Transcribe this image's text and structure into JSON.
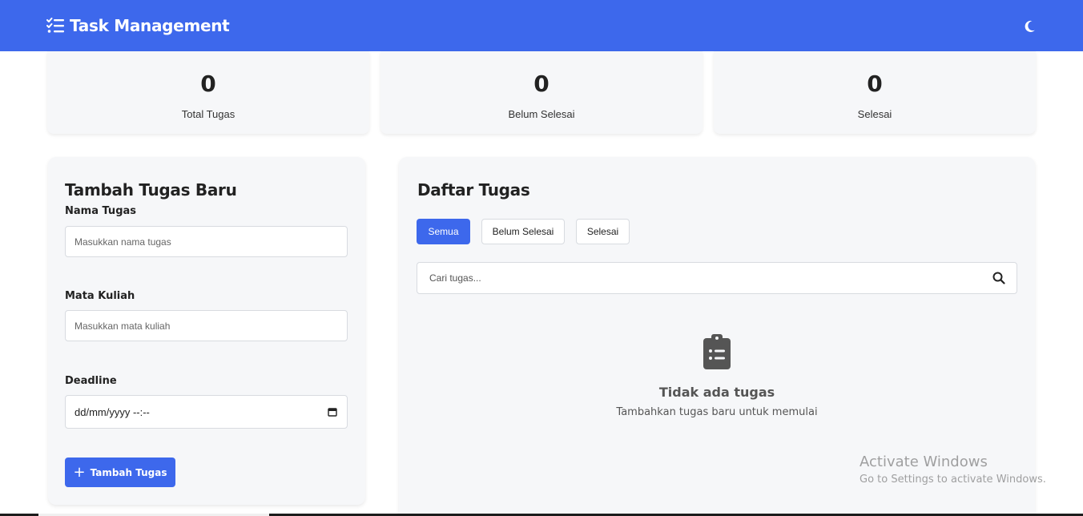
{
  "header": {
    "title": "Task Management",
    "accent": "#3d68ec",
    "theme_toggle_icon": "moon-icon"
  },
  "stats": [
    {
      "value": "0",
      "label": "Total Tugas"
    },
    {
      "value": "0",
      "label": "Belum Selesai"
    },
    {
      "value": "0",
      "label": "Selesai"
    }
  ],
  "form": {
    "title": "Tambah Tugas Baru",
    "name_label": "Nama Tugas",
    "name_placeholder": "Masukkan nama tugas",
    "course_label": "Mata Kuliah",
    "course_placeholder": "Masukkan mata kuliah",
    "deadline_label": "Deadline",
    "deadline_value": "dd/mm/yyyy --:--",
    "submit_label": "Tambah Tugas"
  },
  "list": {
    "title": "Daftar Tugas",
    "filters": [
      "Semua",
      "Belum Selesai",
      "Selesai"
    ],
    "active_filter": "Semua",
    "search_placeholder": "Cari tugas...",
    "empty_title": "Tidak ada tugas",
    "empty_subtitle": "Tambahkan tugas baru untuk memulai"
  },
  "watermark": {
    "title": "Activate Windows",
    "subtitle": "Go to Settings to activate Windows."
  }
}
